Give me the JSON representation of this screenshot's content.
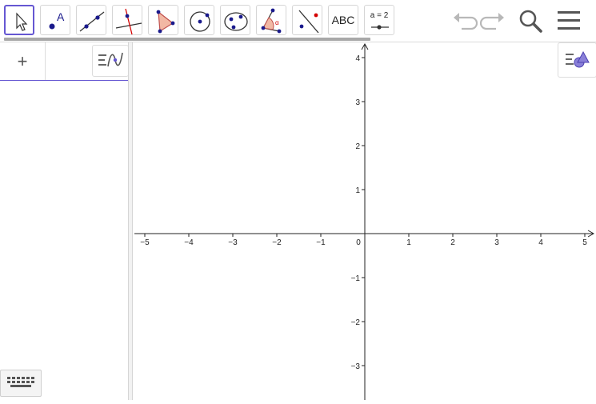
{
  "toolbar": {
    "tools": [
      {
        "name": "move-tool",
        "icon": "pointer-arrow-icon"
      },
      {
        "name": "point-tool",
        "icon": "point-A-icon",
        "label": "A"
      },
      {
        "name": "line-tool",
        "icon": "line-through-points-icon"
      },
      {
        "name": "perpendicular-line-tool",
        "icon": "perpendicular-line-icon"
      },
      {
        "name": "polygon-tool",
        "icon": "polygon-icon"
      },
      {
        "name": "circle-tool",
        "icon": "circle-center-point-icon"
      },
      {
        "name": "ellipse-tool",
        "icon": "ellipse-icon"
      },
      {
        "name": "angle-tool",
        "icon": "angle-icon",
        "label": "α"
      },
      {
        "name": "reflect-tool",
        "icon": "reflect-about-line-icon"
      },
      {
        "name": "text-tool",
        "icon": "text-icon",
        "label": "ABC"
      },
      {
        "name": "slider-tool",
        "icon": "slider-icon",
        "label": "a = 2"
      }
    ],
    "right": [
      "undo-icon",
      "redo-icon",
      "search-icon",
      "menu-icon"
    ]
  },
  "algebra": {
    "add_label": "+"
  },
  "graphics": {
    "x_ticks": [
      "−5",
      "−4",
      "−3",
      "−2",
      "−1",
      "0",
      "1",
      "2",
      "3",
      "4",
      "5"
    ],
    "y_ticks": [
      "4",
      "3",
      "2",
      "1",
      "−1",
      "−2",
      "−3"
    ]
  },
  "colors": {
    "accent": "#6557d2",
    "point": "#1a1a8c",
    "red": "#d40000"
  }
}
